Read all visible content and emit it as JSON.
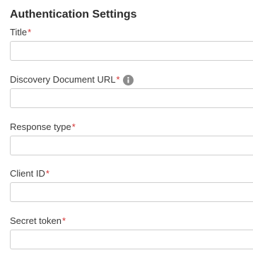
{
  "section": {
    "title": "Authentication Settings"
  },
  "fields": [
    {
      "label": "Title",
      "required_mark": "*",
      "value": "",
      "placeholder": "",
      "has_info_icon": false
    },
    {
      "label": "Discovery Document URL",
      "required_mark": "*",
      "value": "",
      "placeholder": "",
      "has_info_icon": true,
      "info_icon": "info-icon"
    },
    {
      "label": "Response type",
      "required_mark": "*",
      "value": "",
      "placeholder": "",
      "has_info_icon": false
    },
    {
      "label": "Client ID",
      "required_mark": "*",
      "value": "",
      "placeholder": "",
      "has_info_icon": false
    },
    {
      "label": "Secret token",
      "required_mark": "*",
      "value": "",
      "placeholder": "",
      "has_info_icon": false
    }
  ],
  "colors": {
    "required": "#d32f2f",
    "input_border": "#cfcfcf",
    "info_icon_bg": "#8c8c8c"
  }
}
